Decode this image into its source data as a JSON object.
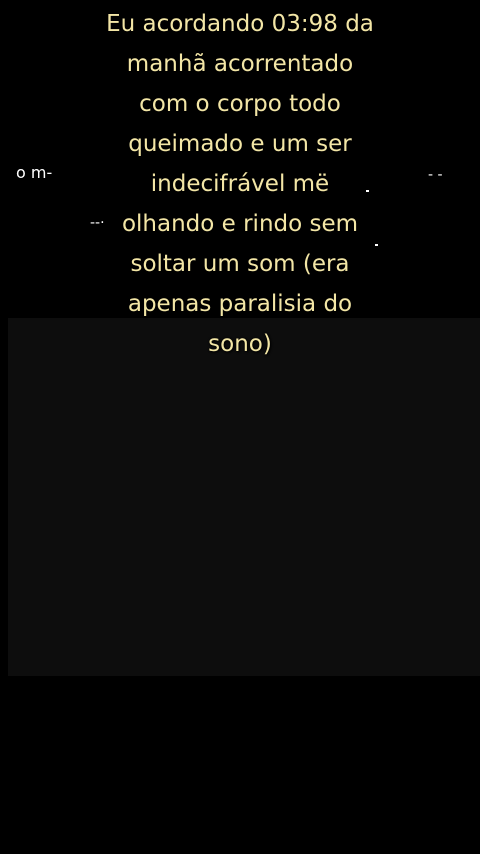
{
  "caption": {
    "lines": [
      "Eu acordando 03:98 da",
      "manhã acorrentado",
      "com o corpo todo",
      "queimado e um ser",
      "indecifrável më",
      "olhando e rindo sem",
      "soltar um som (era",
      "apenas paralisia do",
      "sono)"
    ]
  },
  "background_text": {
    "left_fragment": "o m‑",
    "right_fragment": "‑ ‑",
    "middle_fragment": "‑‑·"
  },
  "colors": {
    "background": "#000000",
    "panel": "#0d0d0d",
    "caption_text": "#f3e6a6",
    "fragment_text": "#ffffff"
  }
}
